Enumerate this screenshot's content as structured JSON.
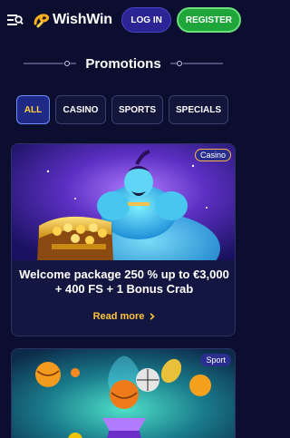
{
  "header": {
    "logo_text": "WishWin",
    "login_label": "LOG IN",
    "register_label": "REGISTER",
    "menu_icon": "menu-search-icon"
  },
  "page": {
    "title": "Promotions"
  },
  "tabs": [
    {
      "label": "ALL",
      "active": true
    },
    {
      "label": "CASINO",
      "active": false
    },
    {
      "label": "SPORTS",
      "active": false
    },
    {
      "label": "SPECIALS",
      "active": false
    }
  ],
  "cards": [
    {
      "badge": "Casino",
      "title": "Welcome package 250 % up to €3,000 + 400 FS + 1 Bonus Crab",
      "cta": "Read more",
      "image": "genie-with-treasure-chest"
    },
    {
      "badge": "Sport",
      "image": "sports-balls-trophy"
    }
  ],
  "colors": {
    "background": "#0b0e2e",
    "accent_gold": "#ffc53a",
    "login_bg": "#2a2494",
    "register_bg": "#1fa63a",
    "active_tab_bg": "#1f2a86"
  }
}
